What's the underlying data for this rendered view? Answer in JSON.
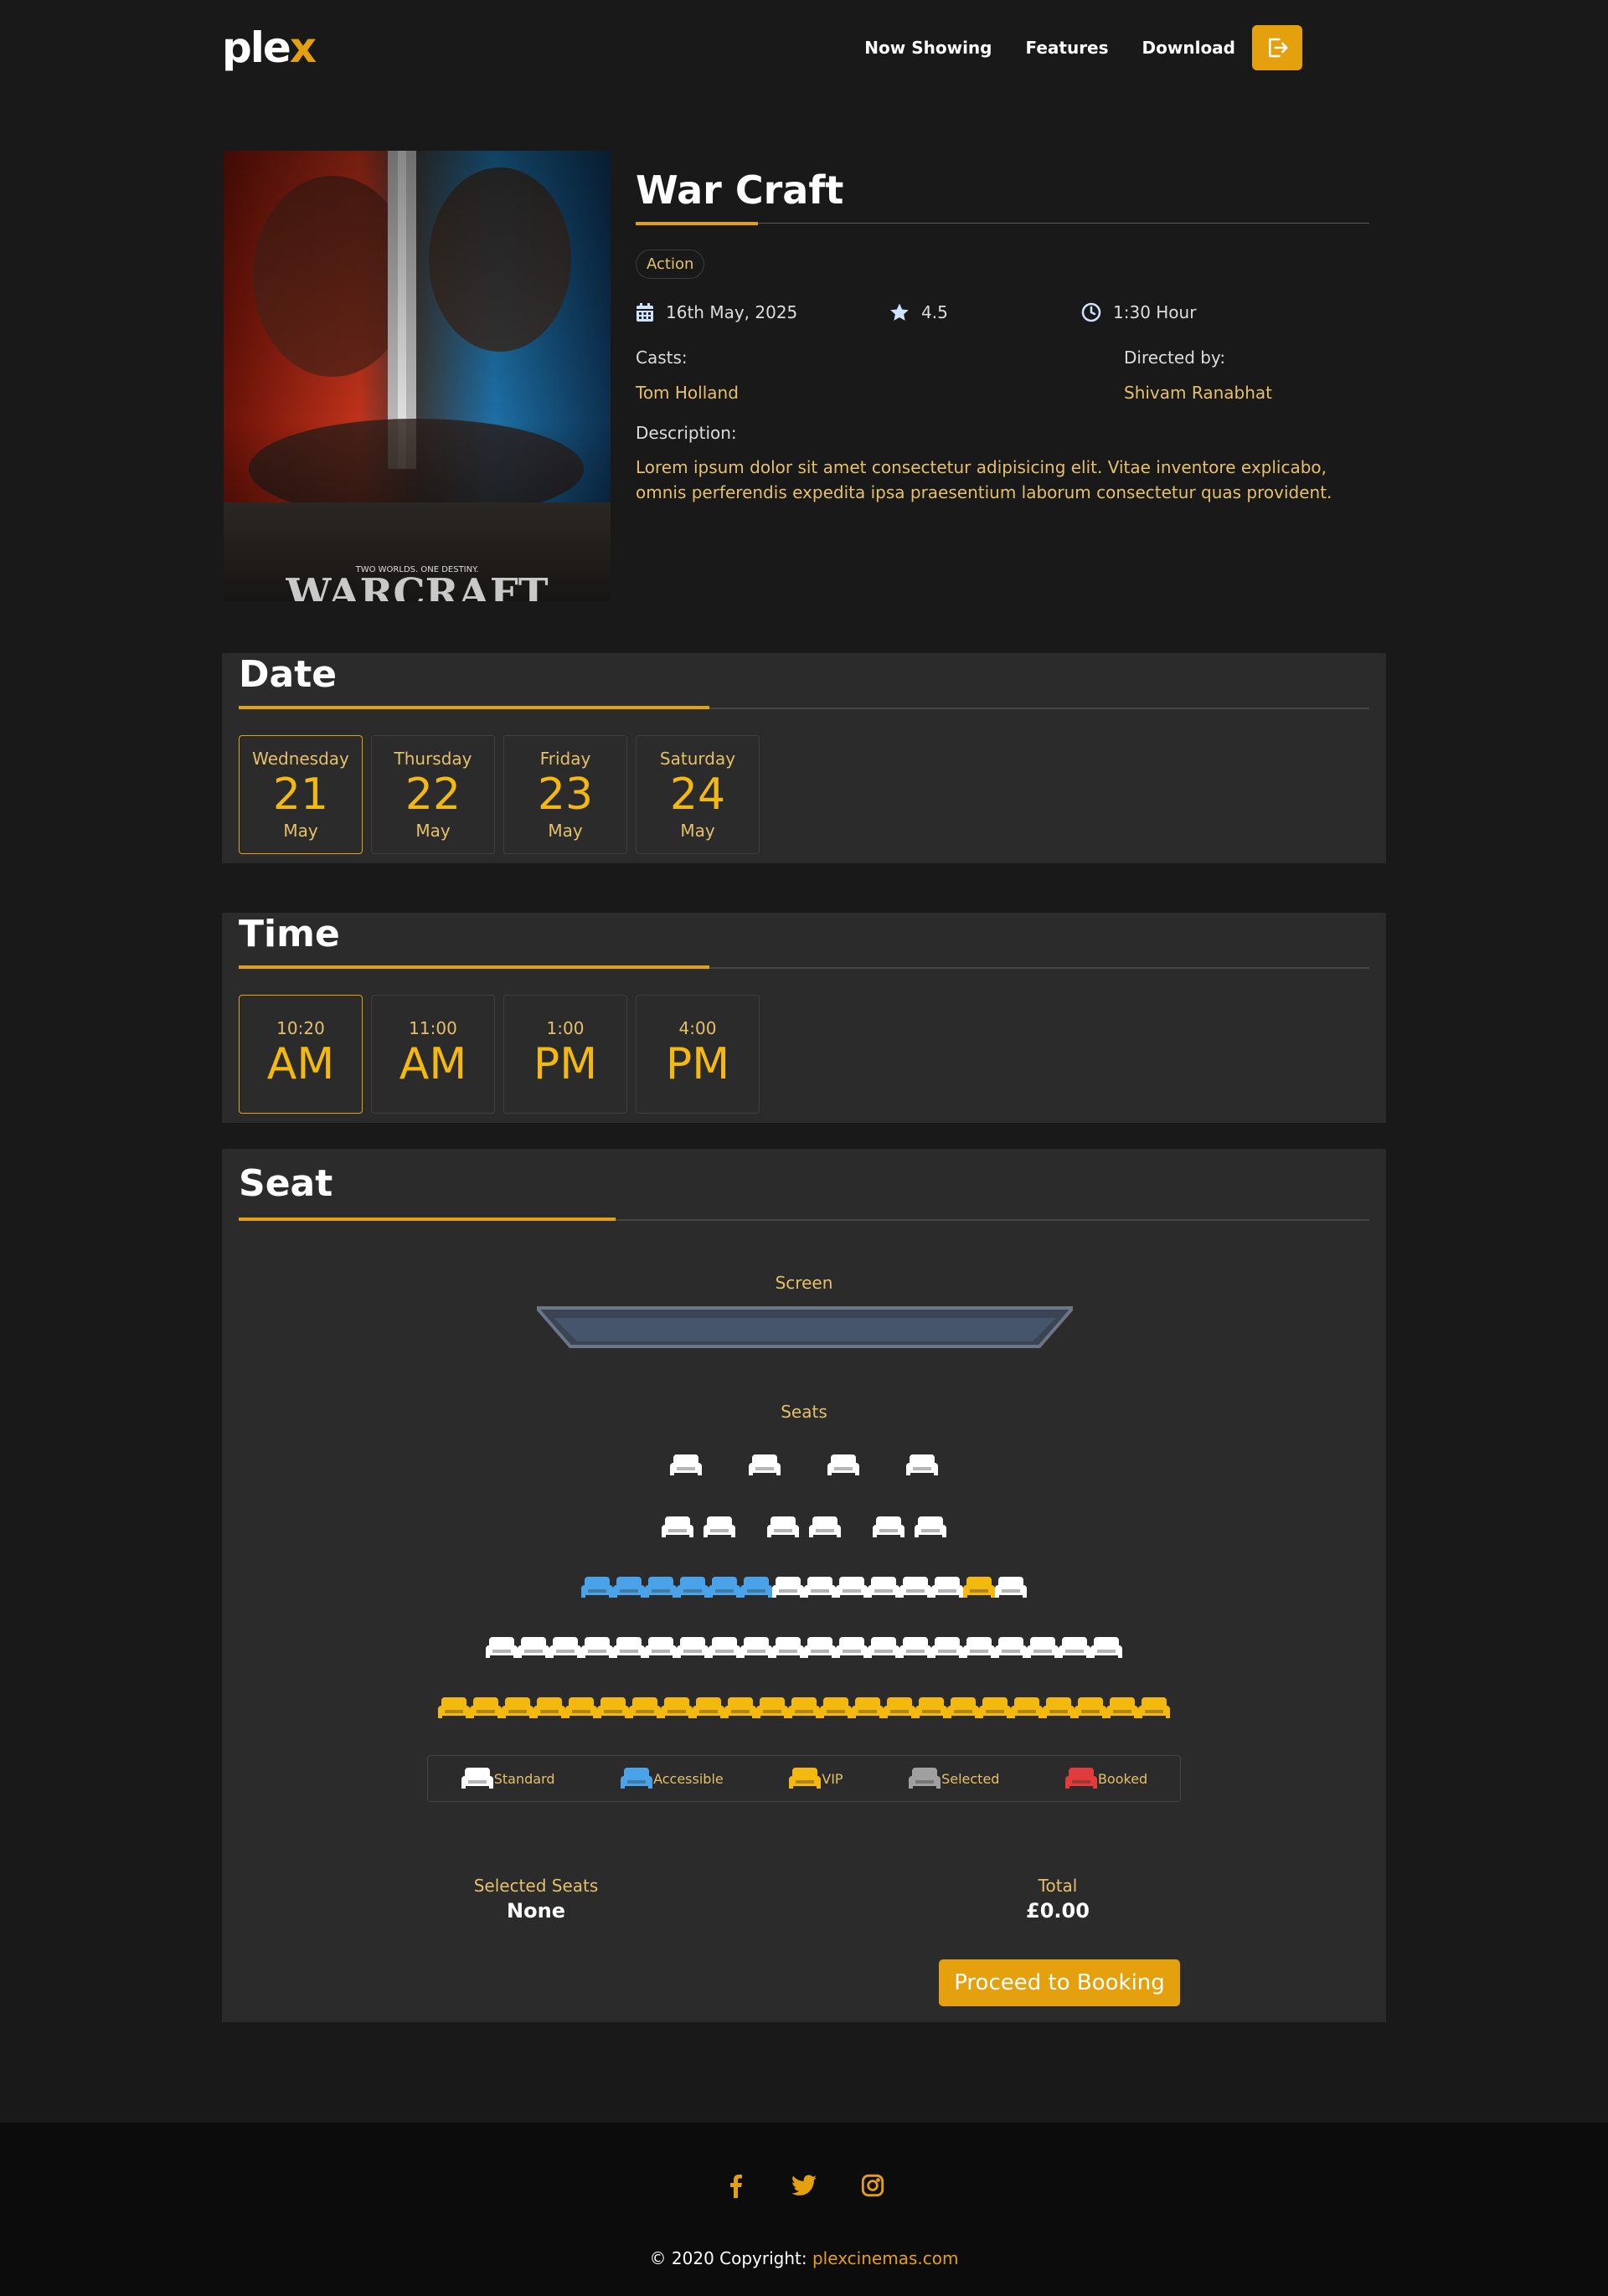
{
  "nav": {
    "logo_main": "ple",
    "logo_x": "x",
    "links": [
      "Now Showing",
      "Features",
      "Download"
    ]
  },
  "movie": {
    "title": "War Craft",
    "genre": "Action",
    "date": "16th May, 2025",
    "rating": "4.5",
    "duration": "1:30 Hour",
    "casts_label": "Casts:",
    "casts": "Tom Holland",
    "director_label": "Directed by:",
    "director": "Shivam Ranabhat",
    "description_label": "Description:",
    "description": "Lorem ipsum dolor sit amet consectetur adipisicing elit. Vitae inventore explicabo, omnis perferendis expedita ipsa praesentium laborum consectetur quas provident.",
    "poster_tagline": "TWO WORLDS. ONE DESTINY.",
    "poster_title": "WARCRAFT"
  },
  "date_section": {
    "title": "Date",
    "options": [
      {
        "day": "Wednesday",
        "num": "21",
        "month": "May",
        "active": true
      },
      {
        "day": "Thursday",
        "num": "22",
        "month": "May",
        "active": false
      },
      {
        "day": "Friday",
        "num": "23",
        "month": "May",
        "active": false
      },
      {
        "day": "Saturday",
        "num": "24",
        "month": "May",
        "active": false
      }
    ]
  },
  "time_section": {
    "title": "Time",
    "options": [
      {
        "time": "10:20",
        "period": "AM",
        "active": true
      },
      {
        "time": "11:00",
        "period": "AM",
        "active": false
      },
      {
        "time": "1:00",
        "period": "PM",
        "active": false
      },
      {
        "time": "4:00",
        "period": "PM",
        "active": false
      }
    ]
  },
  "seat_section": {
    "title": "Seat",
    "screen_label": "Screen",
    "seats_label": "Seats",
    "rows": [
      [
        "standard",
        "gap",
        "standard",
        "gap",
        "standard",
        "gap",
        "standard"
      ],
      [
        "standard",
        "standard",
        "gap",
        "standard",
        "standard",
        "gap",
        "standard",
        "standard"
      ],
      [
        "accessible",
        "accessible",
        "accessible",
        "accessible",
        "accessible",
        "accessible",
        "standard",
        "standard",
        "standard",
        "standard",
        "standard",
        "standard",
        "vip",
        "standard"
      ],
      [
        "standard",
        "standard",
        "standard",
        "standard",
        "standard",
        "standard",
        "standard",
        "standard",
        "standard",
        "standard",
        "standard",
        "standard",
        "standard",
        "standard",
        "standard",
        "standard",
        "standard",
        "standard",
        "standard",
        "standard"
      ],
      [
        "vip",
        "vip",
        "vip",
        "vip",
        "vip",
        "vip",
        "vip",
        "vip",
        "vip",
        "vip",
        "vip",
        "vip",
        "vip",
        "vip",
        "vip",
        "vip",
        "vip",
        "vip",
        "vip",
        "vip",
        "vip",
        "vip",
        "vip"
      ]
    ],
    "legend": [
      {
        "label": "Standard",
        "type": "standard"
      },
      {
        "label": "Accessible",
        "type": "accessible"
      },
      {
        "label": "VIP",
        "type": "vip"
      },
      {
        "label": "Selected",
        "type": "selected"
      },
      {
        "label": "Booked",
        "type": "booked"
      }
    ],
    "selected_label": "Selected Seats",
    "selected_value": "None",
    "total_label": "Total",
    "total_value": "£0.00",
    "proceed_label": "Proceed to Booking"
  },
  "seat_colors": {
    "standard": "#ffffff",
    "accessible": "#4aa3e8",
    "vip": "#f4b90f",
    "selected": "#a0a0a0",
    "booked": "#e23b3b"
  },
  "footer": {
    "copyright_prefix": "© 2020 Copyright: ",
    "copyright_link": "plexcinemas.com",
    "socials": [
      "facebook-icon",
      "twitter-icon",
      "instagram-icon"
    ]
  }
}
